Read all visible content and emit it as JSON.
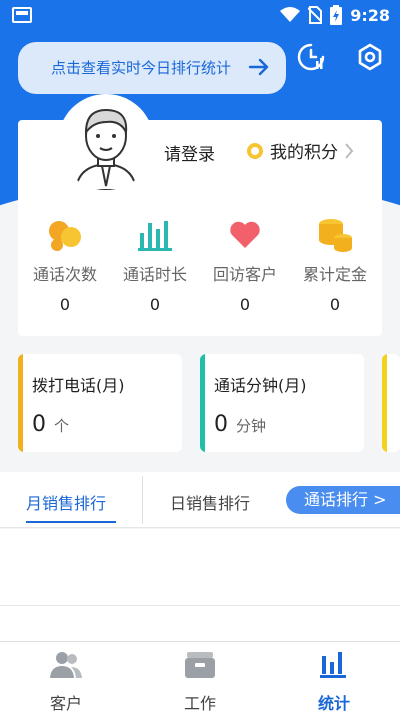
{
  "status_bar": {
    "time": "9:28"
  },
  "banner": {
    "text": "点击查看实时今日排行统计"
  },
  "profile": {
    "login_text": "请登录",
    "points_label": "我的积分"
  },
  "metrics": [
    {
      "label": "通话次数",
      "value": "0",
      "icon": "coins-icon"
    },
    {
      "label": "通话时长",
      "value": "0",
      "icon": "bar-chart-icon"
    },
    {
      "label": "回访客户",
      "value": "0",
      "icon": "heart-icon"
    },
    {
      "label": "累计定金",
      "value": "0",
      "icon": "coin-stack-icon"
    }
  ],
  "call_cards": [
    {
      "title": "拨打电话(月)",
      "value": "0",
      "unit": "个",
      "color": "#f2b01e"
    },
    {
      "title": "通话分钟(月)",
      "value": "0",
      "unit": "分钟",
      "color": "#1fbfa8"
    }
  ],
  "tabs": {
    "monthly": "月销售排行",
    "daily": "日销售排行",
    "calls": "通话排行 >"
  },
  "bottom_nav": [
    {
      "label": "客户",
      "icon": "customers-icon",
      "active": false
    },
    {
      "label": "工作",
      "icon": "work-icon",
      "active": false
    },
    {
      "label": "统计",
      "icon": "statistics-icon",
      "active": true
    }
  ],
  "colors": {
    "primary": "#1a73e8",
    "accent": "#1a67d8",
    "inactive": "#9aa0a6"
  }
}
